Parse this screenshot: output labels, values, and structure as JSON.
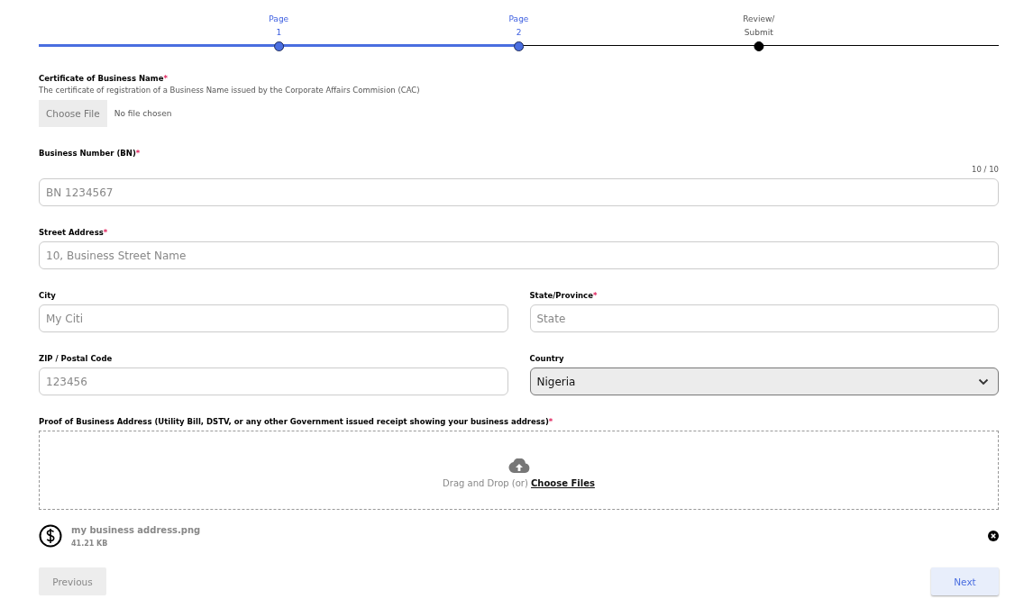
{
  "stepper": {
    "steps": [
      {
        "lines": [
          "Page",
          "1"
        ],
        "reached": true
      },
      {
        "lines": [
          "Page",
          "2"
        ],
        "reached": true
      },
      {
        "lines": [
          "Review/",
          "Submit"
        ],
        "reached": false
      }
    ]
  },
  "certificate": {
    "label": "Certificate of Business Name",
    "required_mark": "*",
    "description": "The certificate of registration of a Business Name issued by the Corporate Affairs Commision (CAC)",
    "button": "Choose File",
    "status": "No file chosen"
  },
  "field_rows": [
    [
      {
        "kind": "text",
        "label": "Business Number (BN)",
        "required_mark": "*",
        "placeholder": "BN 1234567",
        "counter": "10 / 10"
      }
    ],
    [
      {
        "kind": "text",
        "label": "Street Address",
        "required_mark": "*",
        "placeholder": "10, Business Street Name"
      }
    ],
    [
      {
        "kind": "text",
        "label": "City",
        "placeholder": "My Citi"
      },
      {
        "kind": "text",
        "label": "State/Province",
        "required_mark": "*",
        "placeholder": "State"
      }
    ],
    [
      {
        "kind": "text",
        "label": "ZIP / Postal Code",
        "placeholder": "123456"
      },
      {
        "kind": "select",
        "label": "Country",
        "value": "Nigeria"
      }
    ]
  ],
  "proof": {
    "label": "Proof of Business Address (Utility Bill, DSTV, or any other Government issued receipt showing your business address)",
    "required_mark": "*",
    "drop_text": "Drag and Drop (or)",
    "link": "Choose Files"
  },
  "uploaded_files": [
    {
      "name": "my business address.png",
      "size": "41.21 KB"
    }
  ],
  "buttons": {
    "previous": {
      "label": "Previous",
      "disabled": true
    },
    "next": {
      "label": "Next",
      "disabled": false
    }
  }
}
